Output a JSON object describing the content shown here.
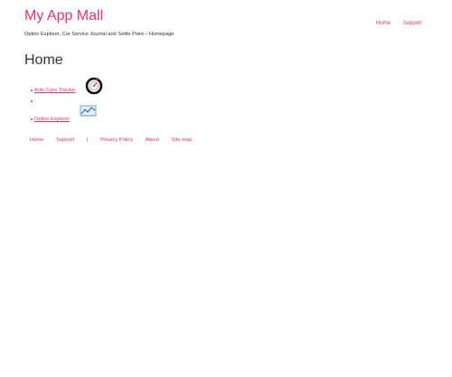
{
  "site": {
    "title": "My App Mall",
    "description": "Option Explorer, Car Service Journal and Settle Point – Homepage"
  },
  "top_nav": {
    "home": "Home",
    "support": "Support"
  },
  "main": {
    "page_title": "Home",
    "apps": [
      {
        "label": "Auto Care Tracker",
        "icon": "car-gauge-icon"
      },
      {
        "label": "",
        "icon": ""
      },
      {
        "label": "Option Explorer",
        "icon": "chart-icon"
      }
    ]
  },
  "footer_nav": {
    "home": "Home",
    "support": "Support",
    "separator": "|",
    "privacy": "Privacy Policy",
    "about": "About",
    "sitemap": "Site map"
  },
  "colors": {
    "accent": "#e8336d",
    "text": "#333333",
    "icon_blue": "#4a8fd8"
  }
}
